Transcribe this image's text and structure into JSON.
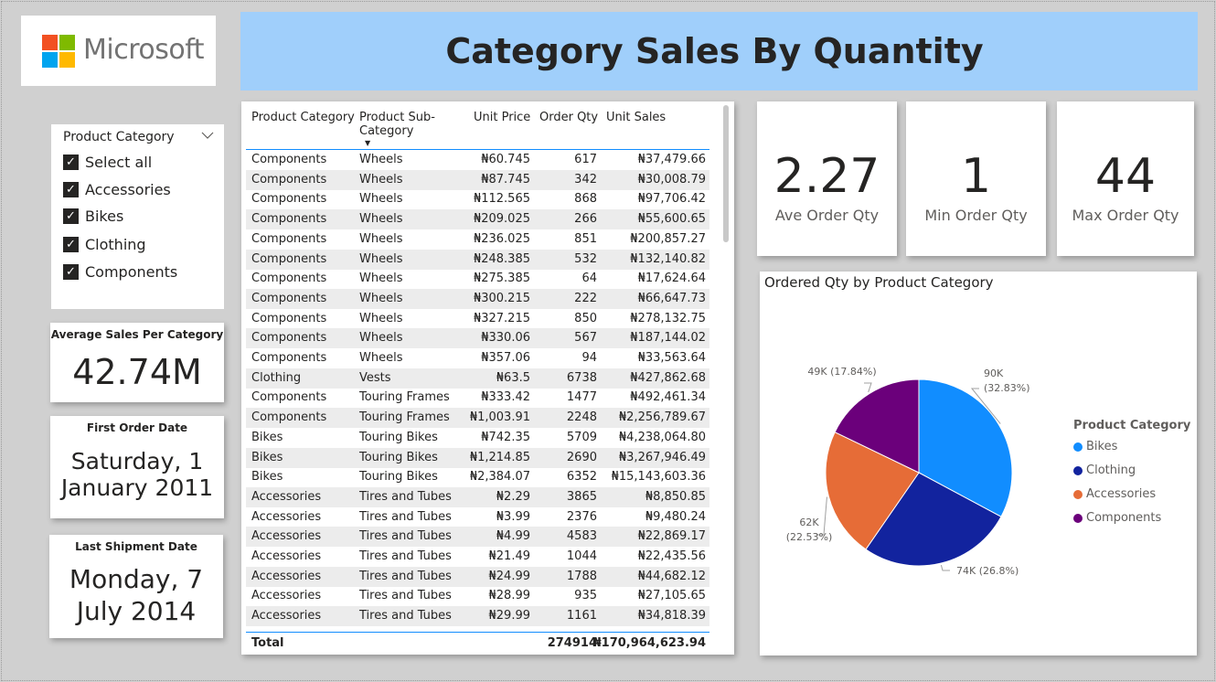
{
  "brand": {
    "name": "Microsoft"
  },
  "title": "Category Sales By Quantity",
  "colors": {
    "title_bg": "#a0cffb",
    "ms_red": "#f25022",
    "ms_green": "#7fba00",
    "ms_blue": "#00a4ef",
    "ms_yellow": "#ffb900",
    "header_line": "#118dff"
  },
  "slicer": {
    "title": "Product Category",
    "chevron_icon": "chevron-down-icon",
    "items": [
      {
        "label": "Select all",
        "checked": true
      },
      {
        "label": "Accessories",
        "checked": true
      },
      {
        "label": "Bikes",
        "checked": true
      },
      {
        "label": "Clothing",
        "checked": true
      },
      {
        "label": "Components",
        "checked": true
      }
    ]
  },
  "cards": {
    "avg_sales": {
      "label": "Average Sales Per Category",
      "value": "42.74M"
    },
    "first_order": {
      "label": "First Order Date",
      "value_line1": "Saturday, 1",
      "value_line2": "January 2011"
    },
    "last_shipment": {
      "label": "Last Shipment Date",
      "value_line1": "Monday, 7",
      "value_line2": "July 2014"
    },
    "ave_order_qty": {
      "label": "Ave Order Qty",
      "value": "2.27"
    },
    "min_order_qty": {
      "label": "Min Order Qty",
      "value": "1"
    },
    "max_order_qty": {
      "label": "Max Order Qty",
      "value": "44"
    }
  },
  "table": {
    "headers": {
      "category": "Product Category",
      "subcat_line1": "Product Sub-",
      "subcat_line2": "Category",
      "unit_price": "Unit Price",
      "order_qty": "Order Qty",
      "unit_sales": "Unit Sales"
    },
    "sort_icon": "sort-descending-icon",
    "rows": [
      [
        "Components",
        "Wheels",
        "₦60.745",
        "617",
        "₦37,479.66"
      ],
      [
        "Components",
        "Wheels",
        "₦87.745",
        "342",
        "₦30,008.79"
      ],
      [
        "Components",
        "Wheels",
        "₦112.565",
        "868",
        "₦97,706.42"
      ],
      [
        "Components",
        "Wheels",
        "₦209.025",
        "266",
        "₦55,600.65"
      ],
      [
        "Components",
        "Wheels",
        "₦236.025",
        "851",
        "₦200,857.27"
      ],
      [
        "Components",
        "Wheels",
        "₦248.385",
        "532",
        "₦132,140.82"
      ],
      [
        "Components",
        "Wheels",
        "₦275.385",
        "64",
        "₦17,624.64"
      ],
      [
        "Components",
        "Wheels",
        "₦300.215",
        "222",
        "₦66,647.73"
      ],
      [
        "Components",
        "Wheels",
        "₦327.215",
        "850",
        "₦278,132.75"
      ],
      [
        "Components",
        "Wheels",
        "₦330.06",
        "567",
        "₦187,144.02"
      ],
      [
        "Components",
        "Wheels",
        "₦357.06",
        "94",
        "₦33,563.64"
      ],
      [
        "Clothing",
        "Vests",
        "₦63.5",
        "6738",
        "₦427,862.68"
      ],
      [
        "Components",
        "Touring Frames",
        "₦333.42",
        "1477",
        "₦492,461.34"
      ],
      [
        "Components",
        "Touring Frames",
        "₦1,003.91",
        "2248",
        "₦2,256,789.67"
      ],
      [
        "Bikes",
        "Touring Bikes",
        "₦742.35",
        "5709",
        "₦4,238,064.80"
      ],
      [
        "Bikes",
        "Touring Bikes",
        "₦1,214.85",
        "2690",
        "₦3,267,946.49"
      ],
      [
        "Bikes",
        "Touring Bikes",
        "₦2,384.07",
        "6352",
        "₦15,143,603.36"
      ],
      [
        "Accessories",
        "Tires and Tubes",
        "₦2.29",
        "3865",
        "₦8,850.85"
      ],
      [
        "Accessories",
        "Tires and Tubes",
        "₦3.99",
        "2376",
        "₦9,480.24"
      ],
      [
        "Accessories",
        "Tires and Tubes",
        "₦4.99",
        "4583",
        "₦22,869.17"
      ],
      [
        "Accessories",
        "Tires and Tubes",
        "₦21.49",
        "1044",
        "₦22,435.56"
      ],
      [
        "Accessories",
        "Tires and Tubes",
        "₦24.99",
        "1788",
        "₦44,682.12"
      ],
      [
        "Accessories",
        "Tires and Tubes",
        "₦28.99",
        "935",
        "₦27,105.65"
      ],
      [
        "Accessories",
        "Tires and Tubes",
        "₦29.99",
        "1161",
        "₦34,818.39"
      ]
    ],
    "total": {
      "label": "Total",
      "order_qty": "274914",
      "unit_sales": "₦170,964,623.94"
    }
  },
  "chart_data": {
    "type": "pie",
    "title": "Ordered Qty by Product Category",
    "legend_title": "Product Category",
    "legend_position": "right",
    "slices": [
      {
        "name": "Bikes",
        "label_value": "90K",
        "label_pct": "(32.83%)",
        "percent": 32.83,
        "color": "#118dff"
      },
      {
        "name": "Clothing",
        "label_value": "74K (26.8%)",
        "label_pct": "",
        "percent": 26.8,
        "color": "#12239e"
      },
      {
        "name": "Accessories",
        "label_value": "62K",
        "label_pct": "(22.53%)",
        "percent": 22.53,
        "color": "#e66c37"
      },
      {
        "name": "Components",
        "label_value": "49K (17.84%)",
        "label_pct": "",
        "percent": 17.84,
        "color": "#6b007b"
      }
    ]
  }
}
